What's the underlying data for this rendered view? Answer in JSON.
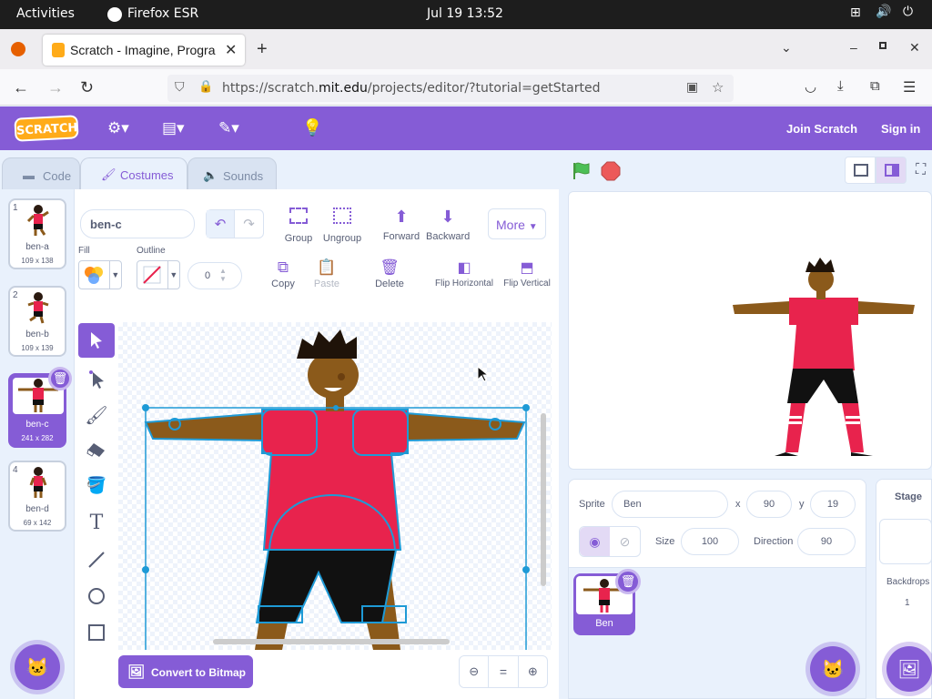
{
  "system": {
    "activities": "Activities",
    "app": "Firefox ESR",
    "datetime": "Jul 19  13:52"
  },
  "browser": {
    "tab_title": "Scratch - Imagine, Program",
    "url_prefix": "https://scratch.",
    "url_domain": "mit.edu",
    "url_path": "/projects/editor/?tutorial=getStarted"
  },
  "menu": {
    "logo": "SCRATCH",
    "join": "Join Scratch",
    "signin": "Sign in"
  },
  "editor_tabs": [
    {
      "label": "Code"
    },
    {
      "label": "Costumes"
    },
    {
      "label": "Sounds"
    }
  ],
  "costumes": [
    {
      "index": "1",
      "name": "ben-a",
      "size": "109 x 138"
    },
    {
      "index": "2",
      "name": "ben-b",
      "size": "109 x 139"
    },
    {
      "index": "3",
      "name": "ben-c",
      "size": "241 x 282"
    },
    {
      "index": "4",
      "name": "ben-d",
      "size": "69 x 142"
    }
  ],
  "paint": {
    "costume_name": "ben-c",
    "group": "Group",
    "ungroup": "Ungroup",
    "forward": "Forward",
    "backward": "Backward",
    "more": "More",
    "fill_label": "Fill",
    "outline_label": "Outline",
    "outline_width": "0",
    "copy": "Copy",
    "paste": "Paste",
    "delete": "Delete",
    "flip_h": "Flip Horizontal",
    "flip_v": "Flip Vertical",
    "convert": "Convert to Bitmap",
    "zoom_reset": "="
  },
  "sprite": {
    "label": "Sprite",
    "name": "Ben",
    "x_label": "x",
    "x": "90",
    "y_label": "y",
    "y": "19",
    "size_label": "Size",
    "size": "100",
    "dir_label": "Direction",
    "direction": "90",
    "thumb_name": "Ben"
  },
  "stage_panel": {
    "title": "Stage",
    "backdrops_label": "Backdrops",
    "backdrops_count": "1"
  },
  "colors": {
    "accent": "#855cd6",
    "shirt": "#e8234d",
    "skin": "#8b5a1b"
  }
}
